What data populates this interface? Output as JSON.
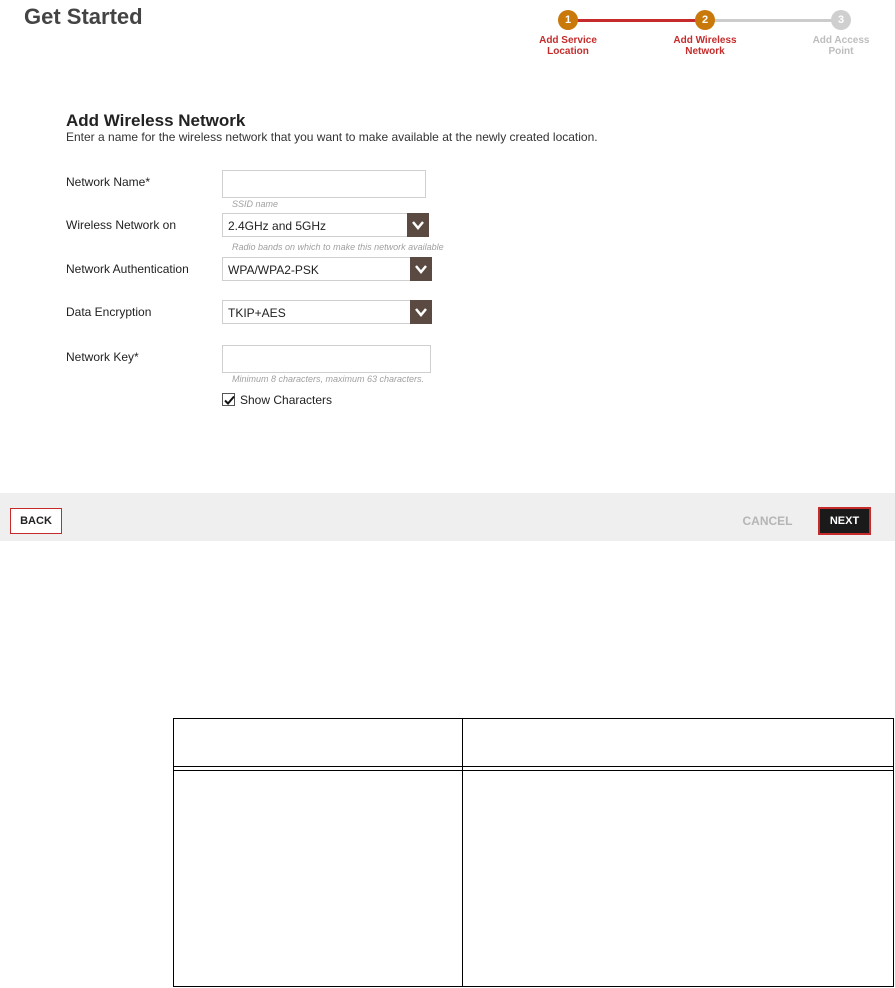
{
  "header": {
    "title": "Get Started"
  },
  "stepper": {
    "steps": [
      {
        "number": "1",
        "label_line1": "Add Service",
        "label_line2": "Location"
      },
      {
        "number": "2",
        "label_line1": "Add Wireless",
        "label_line2": "Network"
      },
      {
        "number": "3",
        "label_line1": "Add Access",
        "label_line2": "Point"
      }
    ],
    "completed_color": "#c62b2b",
    "pending_color": "#cfcfcf"
  },
  "form": {
    "title": "Add Wireless Network",
    "description": "Enter a name for the wireless network that you want to make available at the newly created location.",
    "network_name": {
      "label": "Network Name*",
      "value": "",
      "hint": "SSID name"
    },
    "wireless_network_on": {
      "label": "Wireless Network on",
      "selected": "2.4GHz and 5GHz",
      "hint": "Radio bands on which to make this network available"
    },
    "network_authentication": {
      "label": "Network Authentication",
      "selected": "WPA/WPA2-PSK"
    },
    "data_encryption": {
      "label": "Data Encryption",
      "selected": "TKIP+AES"
    },
    "network_key": {
      "label": "Network Key*",
      "value": "",
      "hint": "Minimum 8 characters, maximum 63 characters."
    },
    "show_characters": {
      "label": "Show Characters",
      "checked": true
    }
  },
  "footer": {
    "back_label": "BACK",
    "cancel_label": "CANCEL",
    "next_label": "NEXT"
  }
}
